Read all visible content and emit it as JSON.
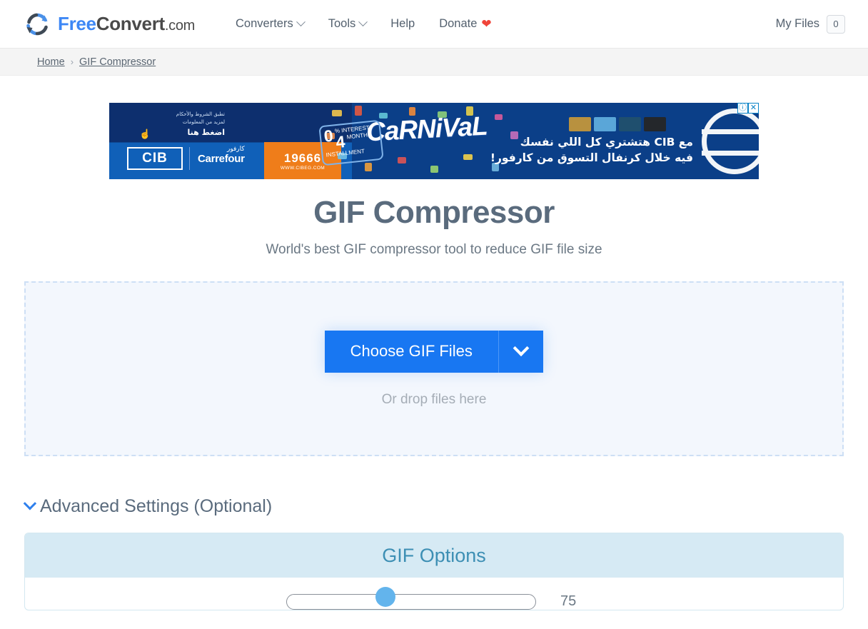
{
  "header": {
    "logo": {
      "icon": "refresh-circle-icon",
      "text_free": "Free",
      "text_convert": "Convert",
      "text_com": ".com"
    },
    "nav": [
      {
        "label": "Converters",
        "has_dropdown": true
      },
      {
        "label": "Tools",
        "has_dropdown": true
      },
      {
        "label": "Help",
        "has_dropdown": false
      },
      {
        "label": "Donate",
        "has_dropdown": false,
        "icon": "heart-icon",
        "heart": "❤"
      }
    ],
    "my_files_label": "My Files",
    "my_files_count": "0"
  },
  "breadcrumb": {
    "home": "Home",
    "separator": "›",
    "current": "GIF Compressor"
  },
  "ad": {
    "arabic_terms_line1": "تطبق الشروط والأحكام",
    "arabic_terms_line2": "لمزيد من المعلومات",
    "arabic_cta": "اضغط هنا",
    "hand_icon": "pointing-hand-icon",
    "cib_logo": "CIB",
    "carrefour_ar": "كارفور",
    "carrefour_en": "Carrefour",
    "phone_number": "19666",
    "phone_url": "WWW.CIBEG.COM",
    "carnival_word": "CaRNiVaL",
    "offer_zero": "0",
    "offer_percent": "% INTEREST",
    "offer_four": "4",
    "offer_months": "MONTHS INSTALLMENT",
    "headline_line1": "مع CIB هتشتري كل اللي نفسك",
    "headline_line2": "فيه خلال كرنفال التسوق من كارفور!",
    "info_icon": "ⓘ",
    "close_icon": "✕"
  },
  "hero": {
    "title": "GIF Compressor",
    "subtitle": "World's best GIF compressor tool to reduce GIF file size"
  },
  "dropzone": {
    "choose_label": "Choose GIF Files",
    "dropdown_icon": "chevron-down-icon",
    "hint": "Or drop files here"
  },
  "advanced": {
    "chevron_icon": "chevron-down-icon",
    "label": "Advanced Settings (Optional)"
  },
  "options": {
    "title": "GIF Options",
    "slider_value": "75"
  },
  "colors": {
    "brand_blue": "#3d87f5",
    "button_blue": "#1877f2",
    "panel_header": "#d6eaf4",
    "panel_title": "#3d8fb4",
    "text_gray": "#5a6b7d",
    "slider_thumb": "#63b4ec",
    "heart_red": "#f0453a"
  }
}
